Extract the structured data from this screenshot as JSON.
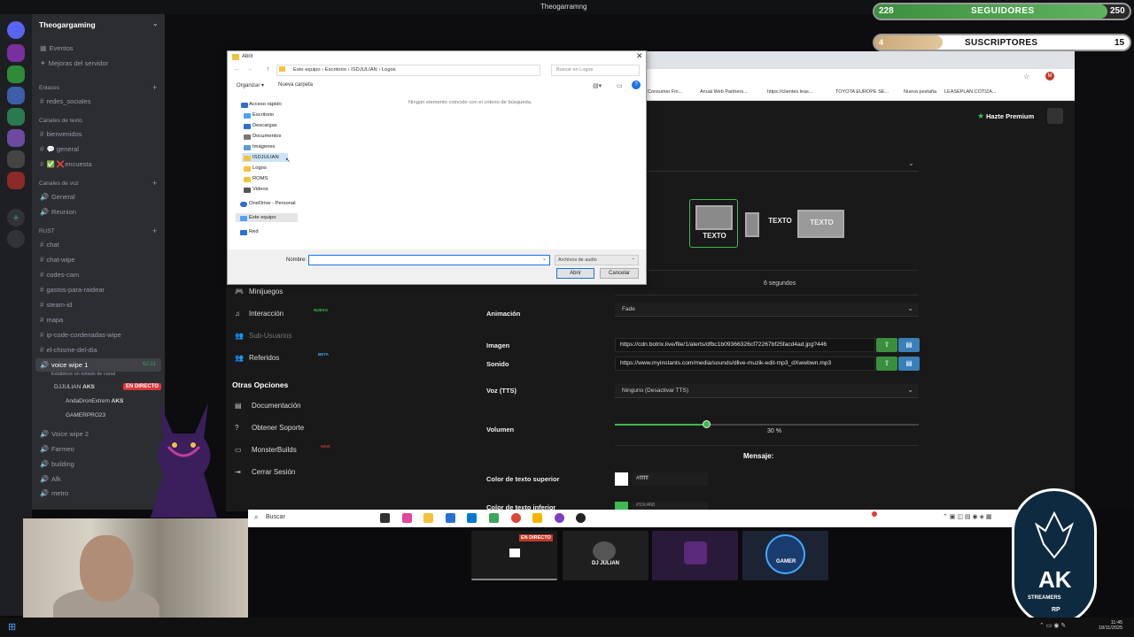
{
  "stream_title": "Theogarramng",
  "discord": {
    "server_name": "Theogargaming",
    "channels_top": [
      {
        "label": "Eventos"
      },
      {
        "label": "Mejoras del servidor"
      }
    ],
    "cat_enlaces": "Enlaces",
    "cat_texto": "Canales de texto",
    "cat_voz": "Canales de voz",
    "cat_rust": "RUST",
    "text_channels": [
      {
        "label": "redes_sociales"
      },
      {
        "label": "bienvenidos"
      },
      {
        "label": "general"
      },
      {
        "label": "encuesta"
      }
    ],
    "voice_channels": [
      {
        "label": "General"
      },
      {
        "label": "Reunion"
      }
    ],
    "rust_channels": [
      {
        "label": "chat"
      },
      {
        "label": "chat-wipe"
      },
      {
        "label": "codes-cam"
      },
      {
        "label": "gastos-para-raidear"
      },
      {
        "label": "steam-id"
      },
      {
        "label": "mapa"
      },
      {
        "label": "ip-code-cordenadas-wipe"
      },
      {
        "label": "el-chisme-del-dia"
      }
    ],
    "active_voice": "voice wipe 1",
    "active_voice_time": "62:21",
    "active_voice_status": "Establece un estado de canal",
    "users": [
      {
        "name": "DJJULIAN",
        "tag": "AKS"
      },
      {
        "name": "AndaDronExtrem",
        "tag": "AKS"
      },
      {
        "name": "GAMERPRO23",
        "tag": ""
      }
    ],
    "live_badge": "EN DIRECTO",
    "more_voice": [
      {
        "label": "Voice wipe 2"
      },
      {
        "label": "Farmeo"
      },
      {
        "label": "building"
      },
      {
        "label": "Afk"
      },
      {
        "label": "metro"
      }
    ]
  },
  "counters": {
    "seguidores": {
      "label": "SEGUIDORES",
      "current": "228",
      "goal": "250",
      "progress": 0.912
    },
    "suscriptores": {
      "label": "SUSCRIPTORES",
      "current": "4",
      "goal": "15",
      "progress": 0.267
    }
  },
  "browser": {
    "bookmarks": [
      "Consumer Fin...",
      "Anual Web Partners...",
      "https://clientes.leas...",
      "TOYOTA EUROPE SE...",
      "Nueva pestaña",
      "LEASEPLAN COTIZA..."
    ],
    "premium": "Hazte Premium"
  },
  "page_menu": {
    "items": [
      {
        "label": "Minijuegos",
        "icon": "gamepad-icon"
      },
      {
        "label": "Interacción",
        "icon": "music-icon",
        "badge": "NUEVO"
      },
      {
        "label": "Sub-Usuarios",
        "icon": "users-icon"
      },
      {
        "label": "Referidos",
        "icon": "users-icon",
        "badge": "BETA"
      }
    ],
    "section": "Otras Opciones",
    "other_items": [
      {
        "label": "Documentación",
        "icon": "doc-icon"
      },
      {
        "label": "Obtener Soporte",
        "icon": "help-icon"
      },
      {
        "label": "MonsterBuilds",
        "icon": "monitor-icon",
        "badge": "NEW"
      },
      {
        "label": "Cerrar Sesión",
        "icon": "logout-icon"
      }
    ]
  },
  "alert_settings": {
    "type_options": [
      "TEXTO",
      "TEXTO",
      "TEXTO"
    ],
    "duration": "6 segundos",
    "animacion_label": "Animación",
    "animacion_value": "Fade",
    "imagen_label": "Imagen",
    "imagen_url": "https://cdn.botrix.live/file/1/alerts/dfbc1b09366326cf72267bf25facd4ad.jpg?446",
    "sonido_label": "Sonido",
    "sonido_url": "https://www.myinstants.com/media/sounds/dlive-muzik-edit-mp3_dXwwbwn.mp3",
    "voz_label": "Voz (TTS)",
    "voz_value": "Ninguno (Desactivar TTS)",
    "volumen_label": "Volumen",
    "volumen_value": "30 %",
    "volumen": 0.3,
    "mensaje_label": "Mensaje:",
    "color_sup_label": "Color de texto superior",
    "color_sup_value": "#ffffff",
    "color_inf_label": "Color de texto inferior",
    "color_inf_value": "#10c468"
  },
  "dialog": {
    "title": "Abrir",
    "path": [
      "Este equipo",
      "Escritorio",
      "ISDJULIAN",
      "Logos"
    ],
    "search_placeholder": "Buscar en Logos",
    "organize": "Organizar",
    "new_folder": "Nueva carpeta",
    "empty_msg": "Ningún elemento coincide con el criterio de búsqueda.",
    "tree": [
      {
        "label": "Acceso rápido"
      },
      {
        "label": "Escritorio"
      },
      {
        "label": "Descargas"
      },
      {
        "label": "Documentos"
      },
      {
        "label": "Imágenes"
      },
      {
        "label": "ISDJULIAN"
      },
      {
        "label": "Logos"
      },
      {
        "label": "ROMS"
      },
      {
        "label": "Videos"
      },
      {
        "label": "OneDrive - Personal"
      },
      {
        "label": "Este equipo"
      },
      {
        "label": "Red"
      }
    ],
    "name_label": "Nombre:",
    "filter": "Archivos de audio",
    "open_btn": "Abrir",
    "cancel_btn": "Cancelar"
  },
  "taskbar": {
    "search": "Buscar"
  },
  "thumbs": {
    "live": "EN DIRECTO",
    "dj": "DJ JULIAN",
    "gamer": "GAMER"
  },
  "logo": {
    "ak": "AK",
    "sub": "STREAMERS",
    "rp": "RP"
  },
  "clock": {
    "time": "11:45",
    "date": "18/11/2025"
  }
}
